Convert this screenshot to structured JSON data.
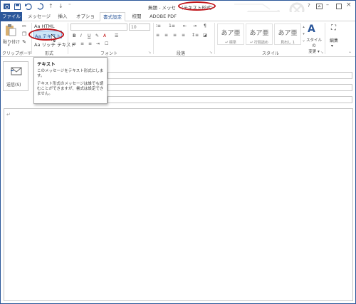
{
  "window": {
    "title_text": "無題 - メッセ",
    "title_format": "(テキスト形式)",
    "help_label": "?"
  },
  "quick_access": {
    "icons": [
      "outlook-icon",
      "save-icon",
      "undo-icon",
      "redo-icon",
      "up-arrow-icon",
      "down-arrow-icon",
      "more-icon"
    ]
  },
  "tabs": [
    {
      "label": "ファイル"
    },
    {
      "label": "メッセージ"
    },
    {
      "label": "挿入"
    },
    {
      "label": "オプション"
    },
    {
      "label": "書式設定"
    },
    {
      "label": "校閲"
    },
    {
      "label": "ADOBE PDF"
    }
  ],
  "ribbon": {
    "clipboard": {
      "paste_label": "貼り付け",
      "group_label": "クリップボード"
    },
    "format": {
      "html_label": "HTML",
      "text_label": "テキスト",
      "rich_label": "リッチ テキスト",
      "aa": "Aa",
      "group_label": "形式"
    },
    "font": {
      "size_value": "10",
      "group_label": "フォント"
    },
    "paragraph": {
      "group_label": "段落"
    },
    "styles": {
      "items": [
        {
          "big": "あア亜",
          "small": "↵ 標準"
        },
        {
          "big": "あア亜",
          "small": "↵ 行間詰め"
        },
        {
          "big": "あア亜",
          "small": "見出し 1"
        }
      ],
      "change_label_1": "スタイルの",
      "change_label_2": "変更",
      "group_label": "スタイル"
    },
    "edit": {
      "label": "編集"
    }
  },
  "compose": {
    "send_label": "送信(S)"
  },
  "tooltip": {
    "title": "テキスト",
    "line1": "このメッセージをテキスト形式にします。",
    "line2": "テキスト形式のメッセージは誰でも読むことができますが、書式は設定できません。"
  },
  "body": {
    "cursor": "↵"
  }
}
